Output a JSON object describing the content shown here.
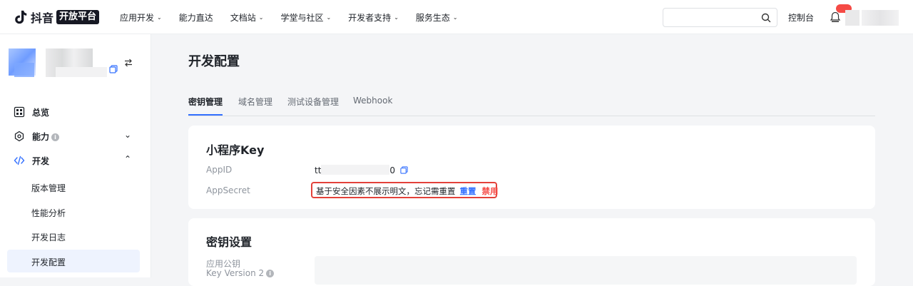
{
  "brand": {
    "name": "抖音",
    "badge": "开放平台"
  },
  "nav": [
    {
      "label": "应用开发",
      "has_menu": true
    },
    {
      "label": "能力直达",
      "has_menu": false
    },
    {
      "label": "文档站",
      "has_menu": true
    },
    {
      "label": "学堂与社区",
      "has_menu": true
    },
    {
      "label": "开发者支持",
      "has_menu": true
    },
    {
      "label": "服务生态",
      "has_menu": true
    }
  ],
  "search": {
    "placeholder": ""
  },
  "header": {
    "console_label": "控制台"
  },
  "sidebar": {
    "menu": [
      {
        "label": "总览",
        "icon": "dashboard-icon"
      },
      {
        "label": "能力",
        "icon": "ability-icon",
        "info": "i",
        "caret": "⌄"
      },
      {
        "label": "开发",
        "icon": "code-icon",
        "caret": "⌃"
      }
    ],
    "sub_items": [
      "版本管理",
      "性能分析",
      "开发日志",
      "开发配置"
    ],
    "active_sub": "开发配置"
  },
  "page": {
    "title": "开发配置",
    "tabs": [
      "密钥管理",
      "域名管理",
      "测试设备管理",
      "Webhook"
    ],
    "active_tab": "密钥管理"
  },
  "key_card": {
    "title": "小程序Key",
    "appid_label": "AppID",
    "appid_prefix": "tt",
    "appid_suffix": "0",
    "appsecret_label": "AppSecret",
    "appsecret_text": "基于安全因素不展示明文，忘记需重置",
    "reset_label": "重置",
    "disable_label": "禁用"
  },
  "settings_card": {
    "title": "密钥设置",
    "pubkey_label_line1": "应用公钥",
    "pubkey_label_line2": "Key Version 2",
    "info": "i"
  },
  "colors": {
    "accent": "#3370ff",
    "danger": "#f54a45",
    "highlight_border": "#e3413a"
  }
}
